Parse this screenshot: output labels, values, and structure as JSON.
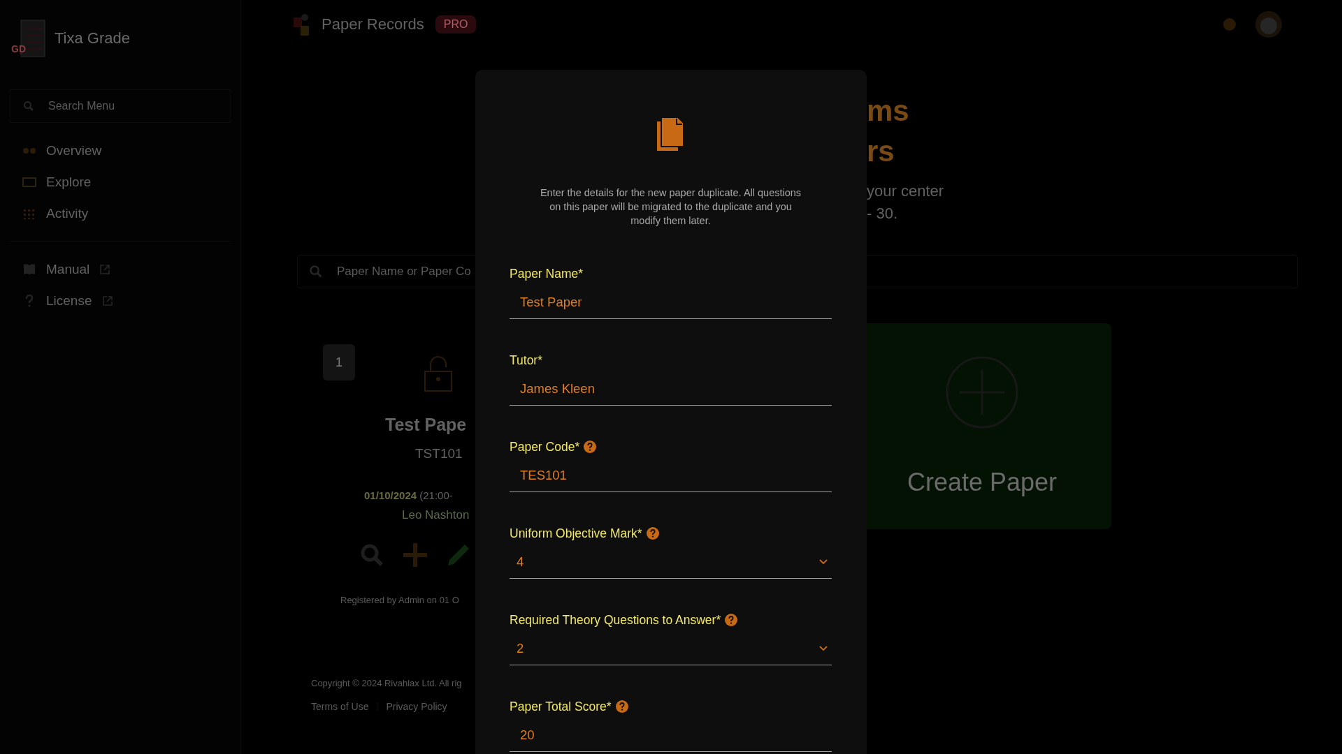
{
  "sidebar": {
    "logo_text": "GD",
    "brand": "Tixa Grade",
    "search": {
      "placeholder": "Search Menu"
    },
    "items": [
      {
        "label": "Overview"
      },
      {
        "label": "Explore"
      },
      {
        "label": "Activity"
      }
    ],
    "links": [
      {
        "label": "Manual"
      },
      {
        "label": "License"
      }
    ]
  },
  "topbar": {
    "title": "Paper Records",
    "badge": "PRO"
  },
  "hero": {
    "heading_lines": [
      "ms",
      "rs"
    ],
    "text_lines": [
      "your center",
      "- 30."
    ]
  },
  "search": {
    "placeholder": "Paper Name or Paper Co"
  },
  "papers": [
    {
      "number": "1",
      "locked": false,
      "name": "Test Pape",
      "code": "TST101",
      "date": "01/10/2024",
      "time": "(21:00-",
      "tutor": "Leo Nashton",
      "registered": "Registered by Admin on 01 O"
    }
  ],
  "create_card": {
    "label": "Create Paper"
  },
  "footer": {
    "copyright": "Copyright © 2024 Rivahlax Ltd. All rig",
    "links": [
      "Terms of Use",
      "Privacy Policy"
    ]
  },
  "modal": {
    "intro": "Enter the details for the new paper duplicate. All questions on this paper will be migrated to the duplicate and you modify them later.",
    "fields": [
      {
        "label": "Paper Name*",
        "kind": "text",
        "value": "Test Paper",
        "help": false
      },
      {
        "label": "Tutor*",
        "kind": "text",
        "value": "James Kleen",
        "help": false
      },
      {
        "label": "Paper Code*",
        "kind": "text",
        "value": "TES101",
        "help": true
      },
      {
        "label": "Uniform Objective Mark*",
        "kind": "select",
        "value": "4",
        "help": true
      },
      {
        "label": "Required Theory Questions to Answer*",
        "kind": "select",
        "value": "2",
        "help": true
      },
      {
        "label": "Paper Total Score*",
        "kind": "text",
        "value": "20",
        "help": true
      }
    ]
  }
}
